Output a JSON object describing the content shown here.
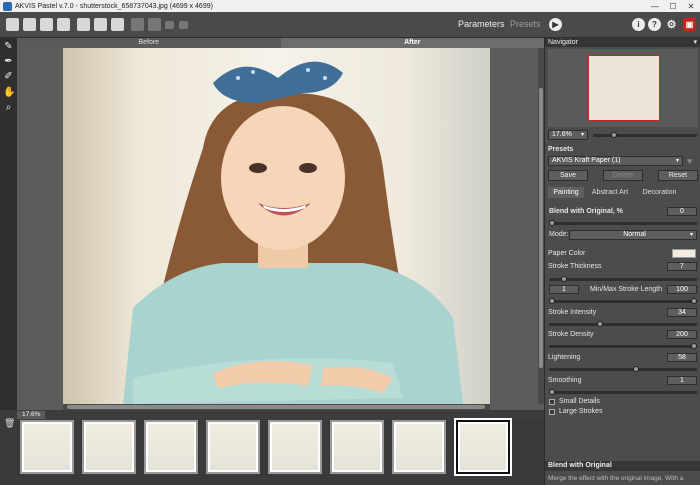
{
  "window": {
    "title": "AKVIS Pastel v.7.0 - shutterstock_658737043.jpg (4699 x 4699)",
    "controls": [
      "—",
      "☐",
      "✕"
    ]
  },
  "toolbar": {
    "parameters_label": "Parameters",
    "presets_label": "Presets",
    "run_icon": "▶",
    "info_icon": "i",
    "help_icon": "?",
    "settings_icon": "⚙",
    "akvis_icon": "▣"
  },
  "left_tools": [
    "✎",
    "✒",
    "✐",
    "✋",
    "⌕"
  ],
  "canvas": {
    "tab_before": "Before",
    "tab_after": "After",
    "zoom_label": "17.6%"
  },
  "filmstrip": {
    "trash_icon": "🗑",
    "thumb_count": 8,
    "selected_index": 7
  },
  "panel": {
    "navigator_title": "Navigator",
    "navigator_collapse": "▾",
    "zoom_value": "17.6%",
    "zoom_arrow": "▾",
    "presets_title": "Presets",
    "preset_selected": "AKVIS Kraft Paper (1)",
    "combo_arrow": "▾",
    "heart_icon": "♥",
    "save_label": "Save",
    "delete_label": "Delete",
    "reset_label": "Reset",
    "tabs": [
      "Painting",
      "Abstract Art",
      "Decoration"
    ],
    "blend_label": "Blend with Original, %",
    "blend_value": "0",
    "mode_label": "Mode:",
    "mode_value": "Normal",
    "paper_color_label": "Paper Color",
    "paper_color": "#f5ece0",
    "stroke_thickness_label": "Stroke Thickness",
    "stroke_thickness_value": "7",
    "min_stroke_value": "1",
    "minmax_label": "Min/Max Stroke Length",
    "max_stroke_value": "100",
    "stroke_intensity_label": "Stroke Intensity",
    "stroke_intensity_value": "34",
    "stroke_density_label": "Stroke Density",
    "stroke_density_value": "200",
    "lightening_label": "Lightening",
    "lightening_value": "58",
    "smoothing_label": "Smoothing",
    "smoothing_value": "1",
    "small_details_label": "Small Details",
    "large_strokes_label": "Large Strokes",
    "hint_title": "Blend with Original",
    "hint_text": "Merge the effect with the original image. With a"
  },
  "colors": {
    "panel_bg": "#4c4c4c",
    "header_bg": "#353535",
    "selected_outline": "#c8231c"
  }
}
